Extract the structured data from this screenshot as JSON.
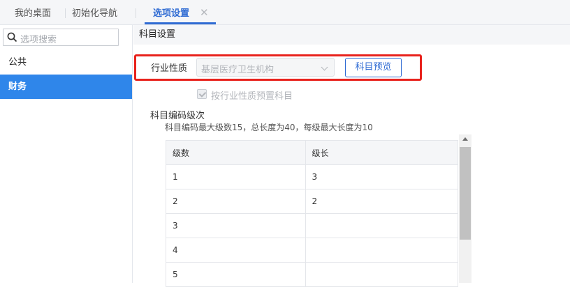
{
  "tabs": [
    {
      "label": "我的桌面"
    },
    {
      "label": "初始化导航"
    },
    {
      "label": "选项设置",
      "close": "✕"
    }
  ],
  "sidebar": {
    "search_placeholder": "选项搜索",
    "items": [
      {
        "label": "公共"
      },
      {
        "label": "财务"
      }
    ]
  },
  "main": {
    "section_title": "科目设置",
    "industry_label": "行业性质",
    "industry_value": "基层医疗卫生机构",
    "preview_button": "科目预览",
    "preset_checkbox_label": "按行业性质预置科目",
    "code_title": "科目编码级次",
    "code_desc": "科目编码最大级数15，总长度为40，每级最大长度为10",
    "table": {
      "headers": [
        "级数",
        "级长"
      ],
      "rows": [
        [
          "1",
          "3"
        ],
        [
          "2",
          "2"
        ],
        [
          "3",
          ""
        ],
        [
          "4",
          ""
        ],
        [
          "5",
          ""
        ]
      ]
    }
  },
  "colors": {
    "accent": "#2f6bd3",
    "sidebar_active": "#2f86ea",
    "highlight": "#e8221c"
  }
}
